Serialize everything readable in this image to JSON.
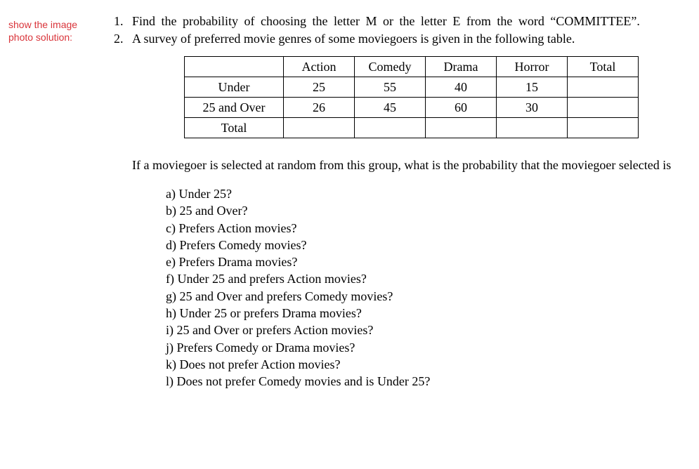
{
  "leftLabel": {
    "line1": "show the image",
    "line2": "photo solution:"
  },
  "q1": "Find the probability of choosing the letter M or the letter E from the word “COMMITTEE”.",
  "q2_intro": "A survey of preferred movie genres of some moviegoers is given in the following table.",
  "table": {
    "headers": [
      "",
      "Action",
      "Comedy",
      "Drama",
      "Horror",
      "Total"
    ],
    "rows": [
      {
        "label": "Under",
        "cells": [
          "25",
          "55",
          "40",
          "15",
          ""
        ]
      },
      {
        "label": "25 and Over",
        "cells": [
          "26",
          "45",
          "60",
          "30",
          ""
        ]
      },
      {
        "label": "Total",
        "cells": [
          "",
          "",
          "",
          "",
          ""
        ]
      }
    ]
  },
  "q2_sub": "If a moviegoer is selected at random from this group, what is the probability that the moviegoer selected is",
  "opts": {
    "a": "a) Under 25?",
    "b": "b) 25 and Over?",
    "c": "c) Prefers Action movies?",
    "d": "d) Prefers Comedy movies?",
    "e": "e) Prefers Drama movies?",
    "f": "f) Under 25 and prefers Action movies?",
    "g": "g) 25 and Over and prefers Comedy movies?",
    "h": "h) Under 25 or prefers Drama movies?",
    "i": "i) 25 and Over or prefers Action movies?",
    "j": "j) Prefers Comedy or Drama movies?",
    "k": "k) Does not prefer Action movies?",
    "l": "l) Does not prefer Comedy movies and is Under 25?"
  }
}
